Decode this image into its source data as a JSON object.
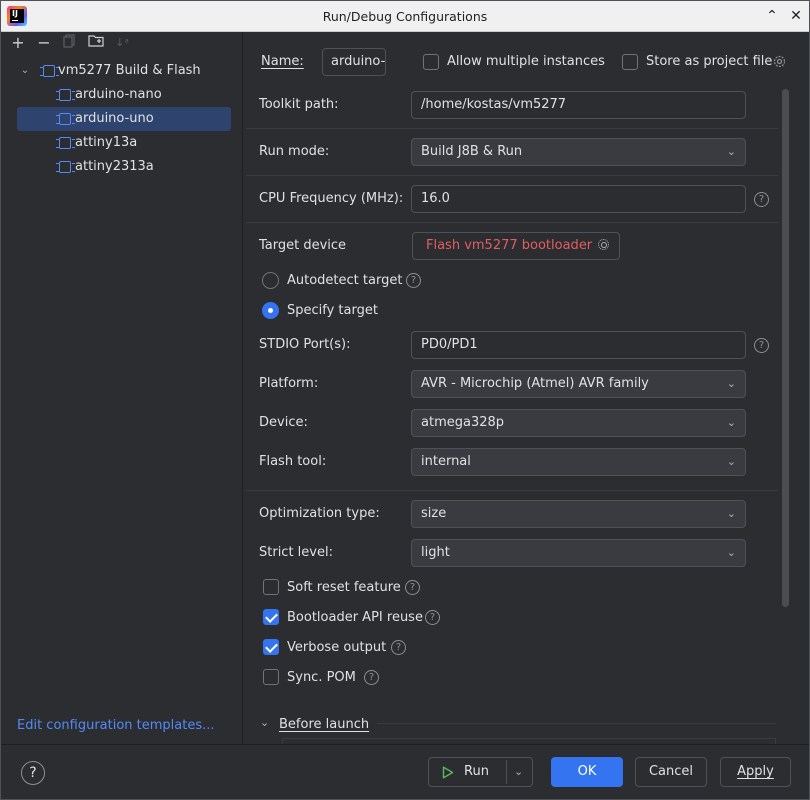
{
  "window": {
    "title": "Run/Debug Configurations",
    "minimize_icon": "chevron-up-icon",
    "close_icon": "close-icon"
  },
  "toolbar": {
    "icons": [
      "add-icon",
      "remove-icon",
      "copy-icon",
      "folder-icon",
      "sort-icon"
    ]
  },
  "tree": {
    "group": {
      "label": "vm5277 Build & Flash",
      "expanded": true
    },
    "items": [
      {
        "label": "arduino-nano",
        "selected": false
      },
      {
        "label": "arduino-uno",
        "selected": true
      },
      {
        "label": "attiny13a",
        "selected": false
      },
      {
        "label": "attiny2313a",
        "selected": false
      }
    ]
  },
  "left_footer": {
    "edit_templates": "Edit configuration templates..."
  },
  "form": {
    "name_label": "Name:",
    "name_value": "arduino-uno",
    "allow_multiple": {
      "label": "Allow multiple instances",
      "checked": false
    },
    "store_project": {
      "label": "Store as project file",
      "checked": false
    },
    "toolkit_path": {
      "label": "Toolkit path:",
      "value": "/home/kostas/vm5277"
    },
    "run_mode": {
      "label": "Run mode:",
      "value": "Build J8B & Run"
    },
    "cpu_freq": {
      "label": "CPU Frequency (MHz):",
      "value": "16.0"
    },
    "target_device": {
      "label": "Target device",
      "button": "Flash vm5277 bootloader"
    },
    "autodetect": {
      "label": "Autodetect target",
      "selected": false
    },
    "specify": {
      "label": "Specify target",
      "selected": true
    },
    "stdio": {
      "label": "STDIO Port(s):",
      "value": "PD0/PD1"
    },
    "platform": {
      "label": "Platform:",
      "value": "AVR - Microchip (Atmel) AVR family"
    },
    "device": {
      "label": "Device:",
      "value": "atmega328p"
    },
    "flash_tool": {
      "label": "Flash tool:",
      "value": "internal"
    },
    "optimization": {
      "label": "Optimization type:",
      "value": "size"
    },
    "strict": {
      "label": "Strict level:",
      "value": "light"
    },
    "soft_reset": {
      "label": "Soft reset feature",
      "checked": false
    },
    "bootloader_api": {
      "label": "Bootloader API reuse",
      "checked": true
    },
    "verbose": {
      "label": "Verbose output",
      "checked": true
    },
    "sync_pom": {
      "label": "Sync. POM",
      "checked": false
    },
    "before_launch": "Before launch"
  },
  "buttons": {
    "help": "?",
    "run": "Run",
    "ok": "OK",
    "cancel": "Cancel",
    "apply": "Apply"
  },
  "colors": {
    "accent": "#3574f0",
    "link": "#548af7",
    "warning_text": "#e35d61",
    "background": "#2b2d30"
  }
}
